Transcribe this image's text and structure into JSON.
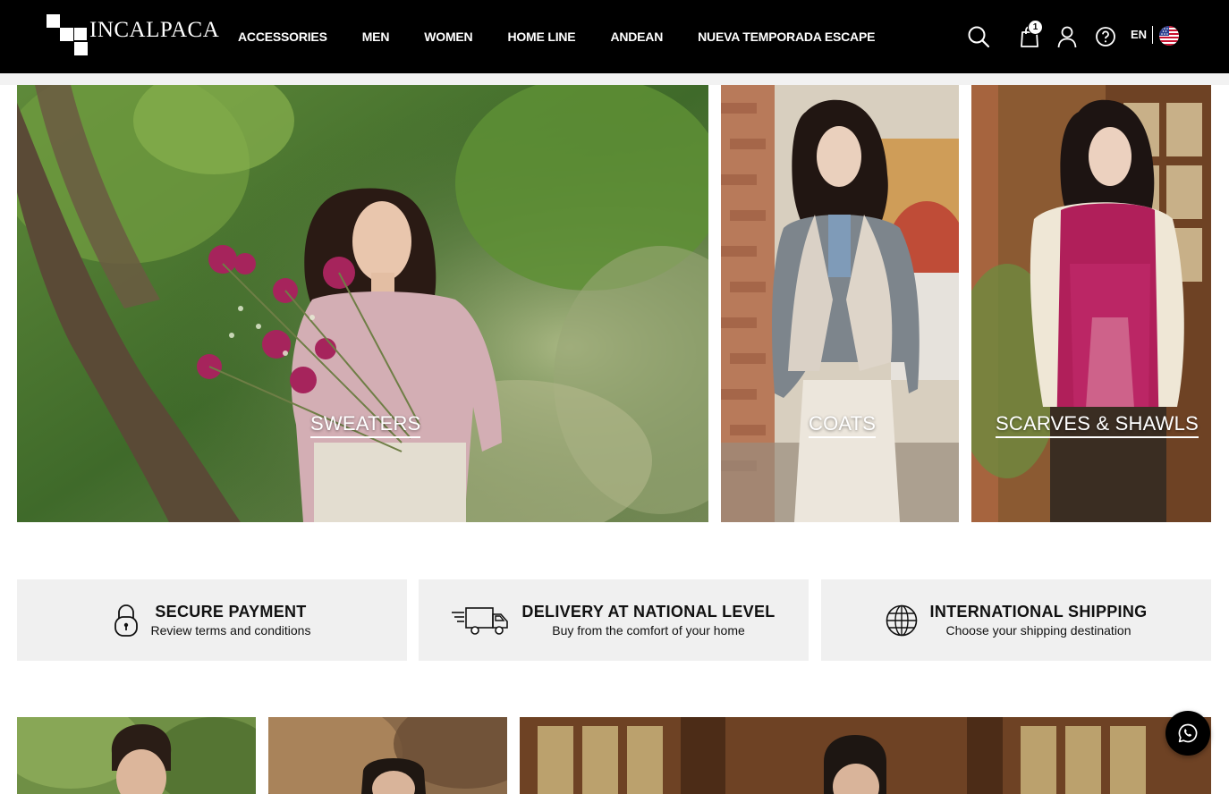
{
  "brand": {
    "name": "INCALPACA"
  },
  "nav": {
    "items": [
      {
        "label": "ACCESSORIES"
      },
      {
        "label": "MEN"
      },
      {
        "label": "WOMEN"
      },
      {
        "label": "HOME LINE"
      },
      {
        "label": "ANDEAN"
      },
      {
        "label": "NUEVA TEMPORADA ESCAPE"
      }
    ]
  },
  "header_actions": {
    "search_icon": "search-icon",
    "cart_icon": "shopping-bag-icon",
    "cart_count": "1",
    "account_icon": "user-icon",
    "help_icon": "help-icon",
    "language": "EN",
    "flag_icon": "us-flag-icon"
  },
  "categories": [
    {
      "label": "SWEATERS"
    },
    {
      "label": "COATS"
    },
    {
      "label": "SCARVES & SHAWLS"
    }
  ],
  "features": [
    {
      "title": "SECURE PAYMENT",
      "subtitle": "Review terms and conditions",
      "icon": "padlock-icon"
    },
    {
      "title": "DELIVERY AT NATIONAL LEVEL",
      "subtitle": "Buy from the comfort of your home",
      "icon": "delivery-truck-icon"
    },
    {
      "title": "INTERNATIONAL SHIPPING",
      "subtitle": "Choose your shipping destination",
      "icon": "globe-icon"
    }
  ],
  "floating": {
    "whatsapp_icon": "whatsapp-icon"
  },
  "colors": {
    "header_bg": "#000000",
    "feature_bg": "#f0f0f0",
    "text": "#111111"
  }
}
